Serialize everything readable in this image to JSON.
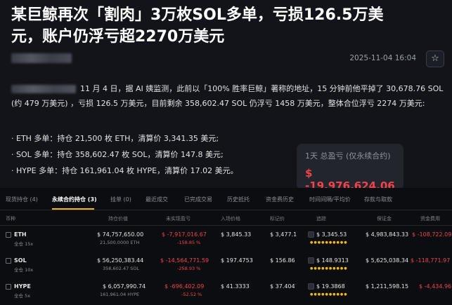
{
  "article": {
    "title_line1": "某巨鲸再次「割肉」3万枚SOL多单，亏损126.5万美",
    "title_line2": "元，账户仍浮亏超2270万美元",
    "date": "2025-11-04 16:04",
    "star_icon": "star-icon",
    "body": "11 月 4 日，据 AI 姨监测，此前以「100% 胜率巨鲸」著称的地址，15 分钟前他平掉了 30,678.76 SOL (约 479 万美元) ，亏损 126.5 万美元，目前剩余 358,602.47 SOL 仍浮亏 1458 万美元，整体合位浮亏 2274 万美元:",
    "bullets": [
      "· ETH 多单：持仓 21,500 枚 ETH，清算价 3,341.35 美元;",
      "· SOL 多单：持仓 358,602.47 枚 SOL，清算价 147.8 美元;",
      "· HYPE 多单：持仓 161,961.04 枚 HYPE，清算价 17.02 美元。"
    ]
  },
  "pnl_card": {
    "label": "1天 总盈亏 (仅永续合约)",
    "value": "$ -19,976,624.06"
  },
  "tabs": [
    "现货持仓 (4)",
    "永续合约持仓 (3)",
    "挂单 (0)",
    "最近成交",
    "已完成交易",
    "历史抵托",
    "资金费历史",
    "时间间隔/平均价",
    "存款与取款"
  ],
  "active_tab": 1,
  "headers": [
    "币种",
    "持仓价值",
    "未实现盈亏",
    "入场价格",
    "标记价",
    "追踪",
    "保证金",
    "资金费用"
  ],
  "rows": [
    {
      "coin": "ETH",
      "mode": "全仓 15x",
      "value": "$ 74,757,650.00",
      "qty": "21,500.0000 ETH",
      "pnl": "$ -7,917,016.67",
      "pnl_pct": "-158.85 %",
      "entry": "$ 3,845.33",
      "mark": "$ 3,477.1",
      "liq": "$ 3,345.53",
      "margin": "$ 4,983,843.33",
      "funding": "$ -108,722.09"
    },
    {
      "coin": "SOL",
      "mode": "全仓 10x",
      "value": "$ 56,250,383.44",
      "qty": "358,602.47 SOL",
      "pnl": "$ -14,564,771.59",
      "pnl_pct": "-258.93 %",
      "entry": "$ 197.4753",
      "mark": "$ 156.86",
      "liq": "$ 148.9313",
      "margin": "$ 5,625,038.34",
      "funding": "$ -118,771.97"
    },
    {
      "coin": "HYPE",
      "mode": "全仓 5x",
      "value": "$ 6,057,990.74",
      "qty": "161,961.04 HYPE",
      "pnl": "$ -696,402.09",
      "pnl_pct": "-52.52 %",
      "entry": "$ 41.3333",
      "mark": "$ 37.404",
      "liq": "$ 19.3868",
      "margin": "$ 1,211,598.15",
      "funding": "$ -4,434.96"
    }
  ],
  "colors": {
    "negative": "#f0434e",
    "accent": "#f0b90b",
    "coin": "#1fae5d"
  }
}
